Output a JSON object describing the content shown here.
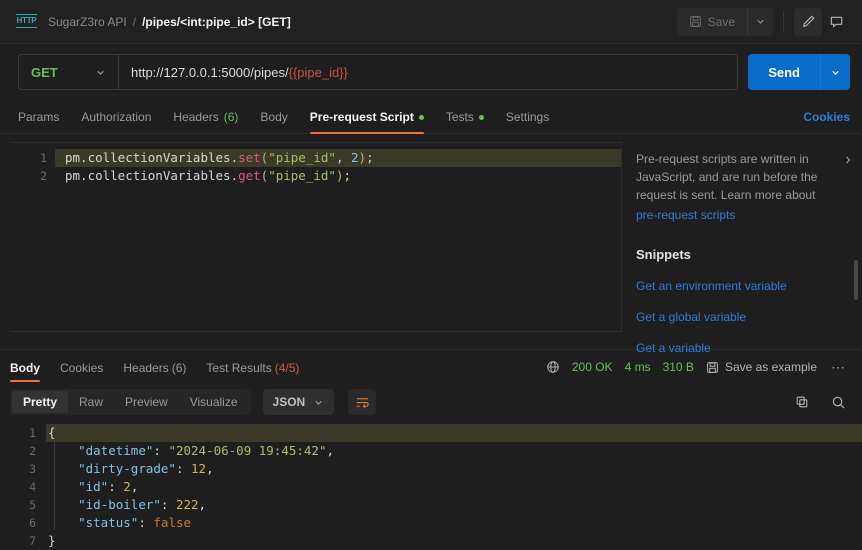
{
  "header": {
    "icon": "http-protocol-icon",
    "collection": "SugarZ3ro API",
    "separator": "/",
    "request_name": "/pipes/<int:pipe_id> [GET]",
    "save_label": "Save",
    "save_icon": "floppy-disk-icon",
    "save_caret_icon": "chevron-down-icon",
    "edit_icon": "pencil-icon",
    "comment_icon": "comment-icon"
  },
  "urlbar": {
    "method": "GET",
    "method_caret": "chevron-down-icon",
    "url_base": "http://127.0.0.1:5000/pipes/",
    "url_variable": "{{pipe_id}}",
    "send_label": "Send",
    "send_caret": "chevron-down-icon"
  },
  "request_tabs": [
    {
      "label": "Params",
      "active": false
    },
    {
      "label": "Authorization",
      "active": false
    },
    {
      "label": "Headers",
      "count": "(6)",
      "active": false
    },
    {
      "label": "Body",
      "active": false
    },
    {
      "label": "Pre-request Script",
      "active": true,
      "dot": true
    },
    {
      "label": "Tests",
      "active": false,
      "dot": true
    },
    {
      "label": "Settings",
      "active": false
    }
  ],
  "cookies_link": "Cookies",
  "script_editor": {
    "lines": [
      {
        "number": "1",
        "active": true,
        "tokens": [
          {
            "text": "pm.collectionVariables.",
            "type": "plain"
          },
          {
            "text": "set",
            "type": "fn"
          },
          {
            "text": "(",
            "type": "paren"
          },
          {
            "text": "\"pipe_id\"",
            "type": "str"
          },
          {
            "text": ", ",
            "type": "plain"
          },
          {
            "text": "2",
            "type": "num"
          },
          {
            "text": ")",
            "type": "paren"
          },
          {
            "text": ";",
            "type": "plain"
          }
        ]
      },
      {
        "number": "2",
        "active": false,
        "tokens": [
          {
            "text": "pm.collectionVariables.",
            "type": "plain"
          },
          {
            "text": "get",
            "type": "fn"
          },
          {
            "text": "(",
            "type": "paren"
          },
          {
            "text": "\"pipe_id\"",
            "type": "str"
          },
          {
            "text": ")",
            "type": "paren"
          },
          {
            "text": ";",
            "type": "plain"
          }
        ]
      }
    ]
  },
  "snippets_panel": {
    "description": "Pre-request scripts are written in JavaScript, and are run before the request is sent. Learn more about",
    "description_link": "pre-request scripts",
    "title": "Snippets",
    "items": [
      "Get an environment variable",
      "Get a global variable",
      "Get a variable"
    ],
    "expand_icon": "chevron-right-icon"
  },
  "response": {
    "tabs": [
      {
        "label": "Body",
        "active": true
      },
      {
        "label": "Cookies",
        "active": false
      },
      {
        "label": "Headers",
        "count": "(6)",
        "count_color": "green",
        "active": false
      },
      {
        "label": "Test Results",
        "count": "(4/5)",
        "count_color": "red",
        "active": false
      }
    ],
    "status": {
      "globe_icon": "globe-icon",
      "code": "200 OK",
      "time": "4 ms",
      "size": "310 B",
      "save_example_icon": "floppy-disk-icon",
      "save_example_label": "Save as example",
      "more_icon": "ellipsis-icon"
    },
    "format_tabs": [
      {
        "label": "Pretty",
        "active": true
      },
      {
        "label": "Raw",
        "active": false
      },
      {
        "label": "Preview",
        "active": false
      },
      {
        "label": "Visualize",
        "active": false
      }
    ],
    "language": "JSON",
    "language_caret": "chevron-down-icon",
    "wrap_icon": "word-wrap-icon",
    "copy_icon": "copy-icon",
    "search_icon": "search-icon",
    "body_lines": [
      {
        "number": "1",
        "active": true,
        "tokens": [
          {
            "text": "{",
            "type": "brace"
          }
        ]
      },
      {
        "number": "2",
        "active": false,
        "tokens": [
          {
            "text": "    ",
            "type": "brace"
          },
          {
            "text": "\"datetime\"",
            "type": "key"
          },
          {
            "text": ": ",
            "type": "brace"
          },
          {
            "text": "\"2024-06-09 19:45:42\"",
            "type": "str"
          },
          {
            "text": ",",
            "type": "brace"
          }
        ]
      },
      {
        "number": "3",
        "active": false,
        "tokens": [
          {
            "text": "    ",
            "type": "brace"
          },
          {
            "text": "\"dirty-grade\"",
            "type": "key"
          },
          {
            "text": ": ",
            "type": "brace"
          },
          {
            "text": "12",
            "type": "num"
          },
          {
            "text": ",",
            "type": "brace"
          }
        ]
      },
      {
        "number": "4",
        "active": false,
        "tokens": [
          {
            "text": "    ",
            "type": "brace"
          },
          {
            "text": "\"id\"",
            "type": "key"
          },
          {
            "text": ": ",
            "type": "brace"
          },
          {
            "text": "2",
            "type": "num"
          },
          {
            "text": ",",
            "type": "brace"
          }
        ]
      },
      {
        "number": "5",
        "active": false,
        "tokens": [
          {
            "text": "    ",
            "type": "brace"
          },
          {
            "text": "\"id-boiler\"",
            "type": "key"
          },
          {
            "text": ": ",
            "type": "brace"
          },
          {
            "text": "222",
            "type": "num"
          },
          {
            "text": ",",
            "type": "brace"
          }
        ]
      },
      {
        "number": "6",
        "active": false,
        "tokens": [
          {
            "text": "    ",
            "type": "brace"
          },
          {
            "text": "\"status\"",
            "type": "key"
          },
          {
            "text": ": ",
            "type": "brace"
          },
          {
            "text": "false",
            "type": "bool"
          }
        ]
      },
      {
        "number": "7",
        "active": false,
        "tokens": [
          {
            "text": "}",
            "type": "brace"
          }
        ]
      }
    ]
  },
  "colors": {
    "accent_orange": "#f1703b",
    "send_blue": "#0b6bcb",
    "link_blue": "#2f7ddb",
    "status_green": "#6bbf59",
    "method_green": "#6bbf59",
    "variable_red": "#c9553c",
    "background": "#1e1e1e"
  }
}
